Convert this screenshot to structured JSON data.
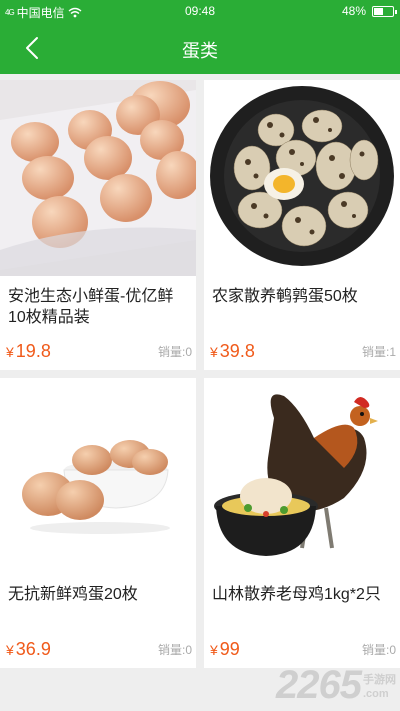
{
  "status_bar": {
    "signal_label": "4G",
    "carrier": "中国电信",
    "time": "09:48",
    "battery": "48%",
    "battery_level": 0.48
  },
  "nav": {
    "title": "蛋类",
    "back_icon": "chevron-left-icon"
  },
  "products": [
    {
      "name": "安池生态小鲜蛋-优亿鲜10枚精品装",
      "currency": "¥",
      "price": "19.8",
      "sales": "销量:0"
    },
    {
      "name": "农家散养鹌鹑蛋50枚",
      "currency": "¥",
      "price": "39.8",
      "sales": "销量:1"
    },
    {
      "name": "无抗新鲜鸡蛋20枚",
      "currency": "¥",
      "price": "36.9",
      "sales": "销量:0"
    },
    {
      "name": "山林散养老母鸡1kg*2只",
      "currency": "¥",
      "price": "99",
      "sales": "销量:0"
    }
  ],
  "watermark": {
    "number": "2265",
    "suffix": ".com",
    "site": "手游网"
  },
  "colors": {
    "brand_green": "#2aad36",
    "price_orange": "#f05a1a",
    "background": "#eeeeee"
  }
}
